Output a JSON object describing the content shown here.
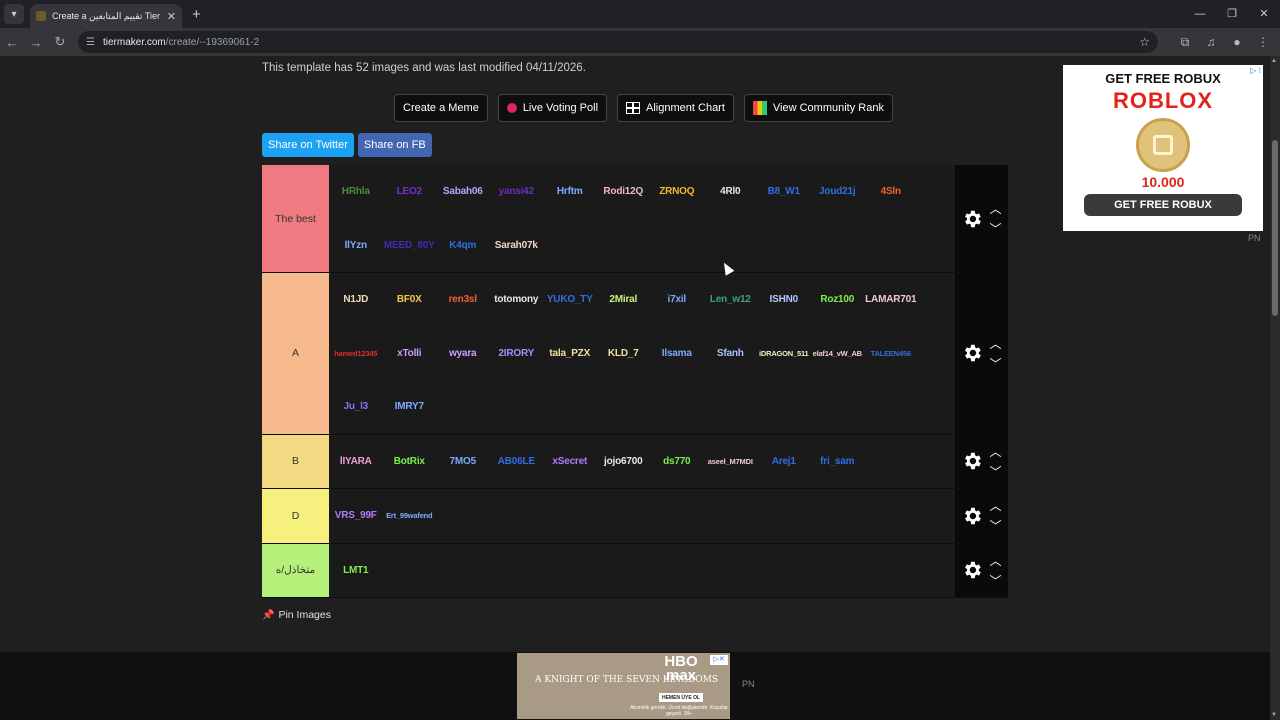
{
  "browser": {
    "tab_title": "Create a تقييم المتابعين Tier List",
    "new_tab": "+",
    "url_host": "tiermaker.com",
    "url_path": "/create/--19369061-2"
  },
  "page": {
    "info_text": "This template has 52 images and was last modified 04/11/2026.",
    "buttons": {
      "meme": "Create a Meme",
      "poll": "Live Voting Poll",
      "alignment": "Alignment Chart",
      "community": "View Community Rank"
    },
    "share": {
      "twitter": "Share on Twitter",
      "fb": "Share on FB"
    },
    "pin_images": "Pin Images"
  },
  "tiers": [
    {
      "label": "The best",
      "color": "#f07a82",
      "items": [
        {
          "text": "HRhla",
          "color": "#4f8a3d"
        },
        {
          "text": "LEO2",
          "color": "#7b2bd1"
        },
        {
          "text": "Sabah06",
          "color": "#b9a4ff"
        },
        {
          "text": "yansi42",
          "color": "#6d2bc2"
        },
        {
          "text": "Hrftm",
          "color": "#7fa9ff"
        },
        {
          "text": "Rodi12Q",
          "color": "#f2b7c8"
        },
        {
          "text": "ZRNOQ",
          "color": "#f2b832"
        },
        {
          "text": "4Rl0",
          "color": "#e6e6e6"
        },
        {
          "text": "B8_W1",
          "color": "#2e6fe0"
        },
        {
          "text": "Joud21j",
          "color": "#2e6fe0"
        },
        {
          "text": "4Sln",
          "color": "#f0622c"
        },
        {
          "text": "llYzn",
          "color": "#7fa9ff"
        },
        {
          "text": "MEED_80Y",
          "color": "#3a2fb0"
        },
        {
          "text": "K4qm",
          "color": "#2e6fe0"
        },
        {
          "text": "Sarah07k",
          "color": "#f0d6c8"
        }
      ]
    },
    {
      "label": "A",
      "color": "#f6b98b",
      "items": [
        {
          "text": "N1JD",
          "color": "#f0ddb0"
        },
        {
          "text": "BF0X",
          "color": "#f2c84a"
        },
        {
          "text": "ren3sl",
          "color": "#f0622c"
        },
        {
          "text": "totomony",
          "color": "#f0e6e6"
        },
        {
          "text": "YUKO_TY",
          "color": "#2e6fe0"
        },
        {
          "text": "2Miral",
          "color": "#c8f07a"
        },
        {
          "text": "i7xil",
          "color": "#7fa9ff"
        },
        {
          "text": "Len_w12",
          "color": "#3aa08a"
        },
        {
          "text": "ISHN0",
          "color": "#b0c8ff"
        },
        {
          "text": "Roz100",
          "color": "#7ef04a"
        },
        {
          "text": "LAMAR701",
          "color": "#f0c8d0"
        },
        {
          "text": "hamed12345",
          "color": "#e02a2a",
          "small": true
        },
        {
          "text": "xTolli",
          "color": "#c8a0ff"
        },
        {
          "text": "wyara",
          "color": "#c8a0ff"
        },
        {
          "text": "2IRORY",
          "color": "#a88cff"
        },
        {
          "text": "tala_PZX",
          "color": "#f0e0a0"
        },
        {
          "text": "KLD_7",
          "color": "#f0e0a0"
        },
        {
          "text": "Ilsama",
          "color": "#7fa9ff"
        },
        {
          "text": "Sfanh",
          "color": "#a8c0ff"
        },
        {
          "text": "iDRAGON_511",
          "color": "#f0f0c0",
          "small": true
        },
        {
          "text": "elaf14_vW_AB",
          "color": "#f0d0d0",
          "small": true
        },
        {
          "text": "TALEEN456",
          "color": "#2e6fe0",
          "small": true
        },
        {
          "text": "Ju_l3",
          "color": "#8a6fff"
        },
        {
          "text": "IMRY7",
          "color": "#7fa9ff"
        }
      ]
    },
    {
      "label": "B",
      "color": "#f4d983",
      "items": [
        {
          "text": "lIYARA",
          "color": "#f0a0d0"
        },
        {
          "text": "BotRix",
          "color": "#7ef04a"
        },
        {
          "text": "7MO5",
          "color": "#7fa9ff"
        },
        {
          "text": "AB06LE",
          "color": "#2e6fe0"
        },
        {
          "text": "xSecret",
          "color": "#b07aff"
        },
        {
          "text": "jojo6700",
          "color": "#f0e6e6"
        },
        {
          "text": "ds770",
          "color": "#7ef04a"
        },
        {
          "text": "aseel_M7MDI",
          "color": "#f0c8d0",
          "small": true
        },
        {
          "text": "Arej1",
          "color": "#2e6fe0"
        },
        {
          "text": "fri_sam",
          "color": "#2e6fe0"
        }
      ]
    },
    {
      "label": "D",
      "color": "#f6f17f",
      "items": [
        {
          "text": "VRS_99F",
          "color": "#b07aff"
        },
        {
          "text": "Ert_99wafend",
          "color": "#7fa9ff",
          "small": true
        }
      ]
    },
    {
      "label": "متخاذل/ه",
      "color": "#b4f07a",
      "items": [
        {
          "text": "LMT1",
          "color": "#7ef04a"
        }
      ]
    }
  ],
  "ads": {
    "roblox": {
      "headline": "GET FREE ROBUX",
      "logo": "ROBLOX",
      "amount": "10.000",
      "cta": "GET FREE ROBUX"
    },
    "pn_label": "PN",
    "hbo": {
      "show": "A KNIGHT OF THE SEVEN KINGDOMS",
      "brand": "HBO max",
      "tag": "HEMEN ÜYE OL",
      "fine": "Abonelik gerekir. Ücret değişkendir. Koşullar geçerli. 18+"
    }
  }
}
